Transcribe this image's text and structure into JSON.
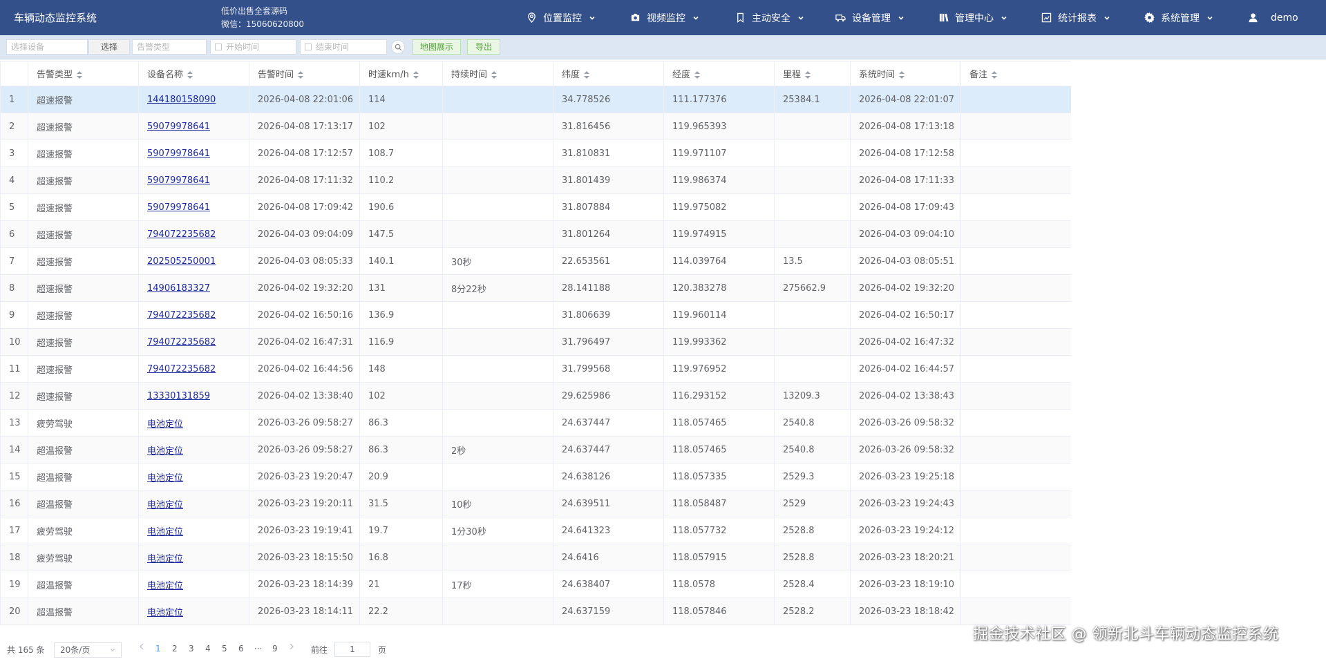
{
  "header": {
    "app_title": "车辆动态监控系统",
    "promo_line1": "低价出售全套源码",
    "promo_line2": "微信：15060620800",
    "nav": [
      {
        "label": "位置监控",
        "icon": "location-icon"
      },
      {
        "label": "视频监控",
        "icon": "camera-icon"
      },
      {
        "label": "主动安全",
        "icon": "bookmark-icon"
      },
      {
        "label": "设备管理",
        "icon": "truck-icon"
      },
      {
        "label": "管理中心",
        "icon": "book-icon"
      },
      {
        "label": "统计报表",
        "icon": "chart-icon"
      },
      {
        "label": "系统管理",
        "icon": "gear-icon"
      }
    ],
    "user": "demo"
  },
  "toolbar": {
    "device_placeholder": "选择设备",
    "select_label": "选择",
    "alarm_type_placeholder": "告警类型",
    "start_placeholder": "开始时间",
    "end_placeholder": "结束时间",
    "map_label": "地图展示",
    "export_label": "导出"
  },
  "table": {
    "columns": [
      "告警类型",
      "设备名称",
      "告警时间",
      "时速km/h",
      "持续时间",
      "纬度",
      "经度",
      "里程",
      "系统时间",
      "备注"
    ],
    "rows": [
      [
        "1",
        "超速报警",
        "144180158090",
        "2026-04-08 22:01:06",
        "114",
        "",
        "34.778526",
        "111.177376",
        "25384.1",
        "2026-04-08 22:01:07",
        ""
      ],
      [
        "2",
        "超速报警",
        "59079978641",
        "2026-04-08 17:13:17",
        "102",
        "",
        "31.816456",
        "119.965393",
        "",
        "2026-04-08 17:13:18",
        ""
      ],
      [
        "3",
        "超速报警",
        "59079978641",
        "2026-04-08 17:12:57",
        "108.7",
        "",
        "31.810831",
        "119.971107",
        "",
        "2026-04-08 17:12:58",
        ""
      ],
      [
        "4",
        "超速报警",
        "59079978641",
        "2026-04-08 17:11:32",
        "110.2",
        "",
        "31.801439",
        "119.986374",
        "",
        "2026-04-08 17:11:33",
        ""
      ],
      [
        "5",
        "超速报警",
        "59079978641",
        "2026-04-08 17:09:42",
        "190.6",
        "",
        "31.807884",
        "119.975082",
        "",
        "2026-04-08 17:09:43",
        ""
      ],
      [
        "6",
        "超速报警",
        "794072235682",
        "2026-04-03 09:04:09",
        "147.5",
        "",
        "31.801264",
        "119.974915",
        "",
        "2026-04-03 09:04:10",
        ""
      ],
      [
        "7",
        "超速报警",
        "202505250001",
        "2026-04-03 08:05:33",
        "140.1",
        "30秒",
        "22.653561",
        "114.039764",
        "13.5",
        "2026-04-03 08:05:51",
        ""
      ],
      [
        "8",
        "超速报警",
        "14906183327",
        "2026-04-02 19:32:20",
        "131",
        "8分22秒",
        "28.141188",
        "120.383278",
        "275662.9",
        "2026-04-02 19:32:20",
        ""
      ],
      [
        "9",
        "超速报警",
        "794072235682",
        "2026-04-02 16:50:16",
        "136.9",
        "",
        "31.806639",
        "119.960114",
        "",
        "2026-04-02 16:50:17",
        ""
      ],
      [
        "10",
        "超速报警",
        "794072235682",
        "2026-04-02 16:47:31",
        "116.9",
        "",
        "31.796497",
        "119.993362",
        "",
        "2026-04-02 16:47:32",
        ""
      ],
      [
        "11",
        "超速报警",
        "794072235682",
        "2026-04-02 16:44:56",
        "148",
        "",
        "31.799568",
        "119.976952",
        "",
        "2026-04-02 16:44:57",
        ""
      ],
      [
        "12",
        "超速报警",
        "13330131859",
        "2026-04-02 13:38:40",
        "102",
        "",
        "29.625986",
        "116.293152",
        "13209.3",
        "2026-04-02 13:38:43",
        ""
      ],
      [
        "13",
        "疲劳驾驶",
        "电池定位",
        "2026-03-26 09:58:27",
        "86.3",
        "",
        "24.637447",
        "118.057465",
        "2540.8",
        "2026-03-26 09:58:32",
        ""
      ],
      [
        "14",
        "超温报警",
        "电池定位",
        "2026-03-26 09:58:27",
        "86.3",
        "2秒",
        "24.637447",
        "118.057465",
        "2540.8",
        "2026-03-26 09:58:32",
        ""
      ],
      [
        "15",
        "超温报警",
        "电池定位",
        "2026-03-23 19:20:47",
        "20.9",
        "",
        "24.638126",
        "118.057335",
        "2529.3",
        "2026-03-23 19:25:18",
        ""
      ],
      [
        "16",
        "超温报警",
        "电池定位",
        "2026-03-23 19:20:11",
        "31.5",
        "10秒",
        "24.639511",
        "118.058487",
        "2529",
        "2026-03-23 19:24:43",
        ""
      ],
      [
        "17",
        "疲劳驾驶",
        "电池定位",
        "2026-03-23 19:19:41",
        "19.7",
        "1分30秒",
        "24.641323",
        "118.057732",
        "2528.8",
        "2026-03-23 19:24:12",
        ""
      ],
      [
        "18",
        "疲劳驾驶",
        "电池定位",
        "2026-03-23 18:15:50",
        "16.8",
        "",
        "24.6416",
        "118.057915",
        "2528.8",
        "2026-03-23 18:20:21",
        ""
      ],
      [
        "19",
        "超温报警",
        "电池定位",
        "2026-03-23 18:14:39",
        "21",
        "17秒",
        "24.638407",
        "118.0578",
        "2528.4",
        "2026-03-23 18:19:10",
        ""
      ],
      [
        "20",
        "超温报警",
        "电池定位",
        "2026-03-23 18:14:11",
        "22.2",
        "",
        "24.637159",
        "118.057846",
        "2528.2",
        "2026-03-23 18:18:42",
        ""
      ]
    ]
  },
  "pager": {
    "total": "共 165 条",
    "page_size": "20条/页",
    "pages": [
      "1",
      "2",
      "3",
      "4",
      "5",
      "6",
      "···",
      "9"
    ],
    "goto_label": "前往",
    "goto_value": "1",
    "goto_suffix": "页"
  },
  "watermark": "掘金技术社区 @ 领新北斗车辆动态监控系统",
  "colors": {
    "header_bg": "#33508a",
    "toolbar_bg": "#dde7f3",
    "selected_row": "#dcecfb",
    "link": "#1e2a9c",
    "active_page": "#409eff"
  }
}
